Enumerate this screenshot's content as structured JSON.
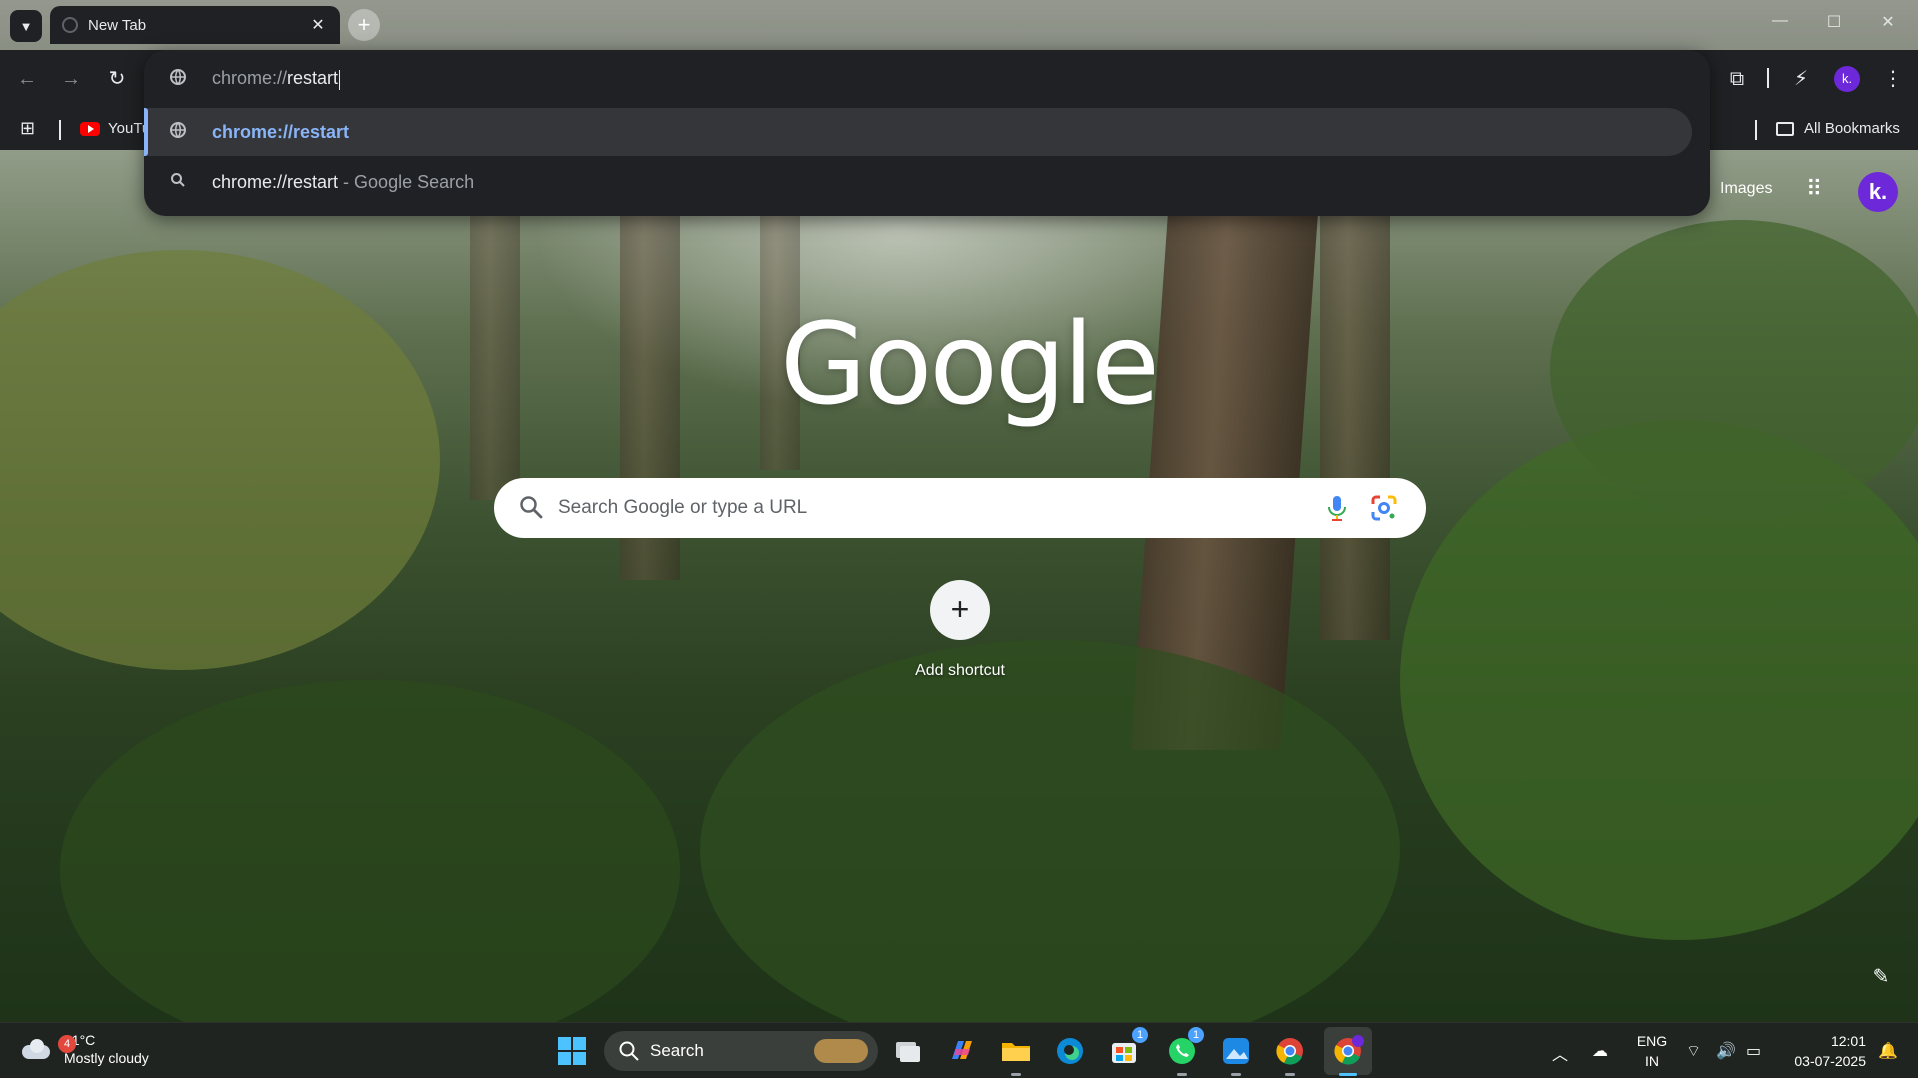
{
  "window": {
    "tab_title": "New Tab",
    "tab_close": "✕",
    "new_tab": "+",
    "minimize": "—",
    "maximize": "☐",
    "close": "✕"
  },
  "omnibox": {
    "typed_prefix": "chrome://",
    "typed_main": "restart",
    "suggestions": [
      {
        "main": "chrome://restart",
        "sub": ""
      },
      {
        "main": "chrome://restart",
        "sub": " - Google Search"
      }
    ]
  },
  "bookmarks": {
    "youtube_label": "YouTu",
    "all_bookmarks": "All Bookmarks"
  },
  "header": {
    "images_link": "Images",
    "avatar_letter": "k.",
    "mini_avatar_letter": "k."
  },
  "logo": {
    "text": "Google"
  },
  "search": {
    "placeholder": "Search Google or type a URL"
  },
  "shortcuts": {
    "add_label": "Add shortcut",
    "add_symbol": "+"
  },
  "taskbar": {
    "weather_badge": "4",
    "temperature": "31°C",
    "condition": "Mostly cloudy",
    "search_label": "Search",
    "store_badge": "1",
    "whatsapp_badge": "1",
    "lang_line1": "ENG",
    "lang_line2": "IN",
    "time": "12:01",
    "date": "03-07-2025"
  },
  "colors": {
    "toolbar_bg": "#202124",
    "accent_blue": "#8ab4f8",
    "avatar_purple": "#6d28d9"
  }
}
